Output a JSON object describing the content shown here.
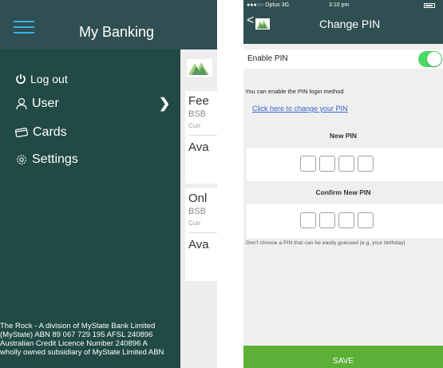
{
  "left_screen": {
    "header": {
      "title": "My Banking"
    },
    "drawer": {
      "logout_label": "Log out",
      "user_label": "User",
      "cards_label": "Cards",
      "settings_label": "Settings",
      "footer_line1": "The Rock - A division of MyState Bank Limited",
      "footer_line2": "(MyState) ABN 89 067 729 195 AFSL 240896",
      "footer_line3": "Australian Credit Licence Number 240896 A",
      "footer_line4": "wholly owned subsidiary of MyState Limited ABN"
    },
    "accounts": [
      {
        "name": "Fee",
        "bsb": "BSB",
        "curr": "Curr",
        "available": "Ava"
      },
      {
        "name": "Onl",
        "bsb": "BSB",
        "curr": "Curr",
        "available": "Ava"
      }
    ]
  },
  "right_screen": {
    "status_bar": {
      "carrier": "●●●○○ Optus  3G",
      "time": "3:10 pm"
    },
    "header": {
      "back_glyph": "<",
      "title": "Change PIN"
    },
    "enable_pin_label": "Enable PIN",
    "enable_pin_on": true,
    "info_text": "You can enable the PIN login method",
    "change_link": "Click here to change your PIN",
    "new_pin_label": "New PIN",
    "confirm_pin_label": "Confirm New PIN",
    "pin_hint": "Don't choose a PIN that can be easily guessed (e.g, your birthday)",
    "save_label": "SAVE"
  },
  "colors": {
    "header": "#2f4f52",
    "drawer": "#214a45",
    "hamburger": "#3bb0e6",
    "toggle_on": "#4cd964",
    "save": "#5cb037",
    "link": "#3a66c9"
  }
}
